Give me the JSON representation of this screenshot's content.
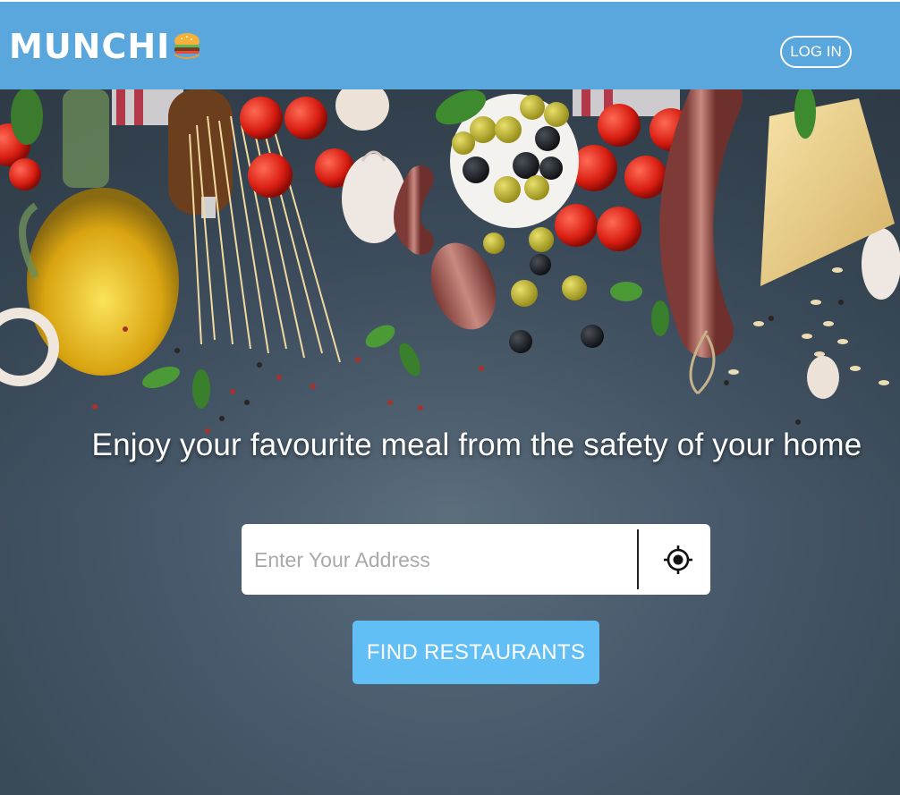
{
  "header": {
    "brand": "MUNCHI",
    "login_label": "LOG IN",
    "background_color": "#5aa7dd"
  },
  "hero": {
    "headline": "Enjoy your favourite meal from the safety of your home"
  },
  "search": {
    "placeholder": "Enter Your Address",
    "value": "",
    "locate_icon": "crosshair-location-icon"
  },
  "cta": {
    "label": "FIND RESTAURANTS",
    "color": "#62bff6"
  }
}
